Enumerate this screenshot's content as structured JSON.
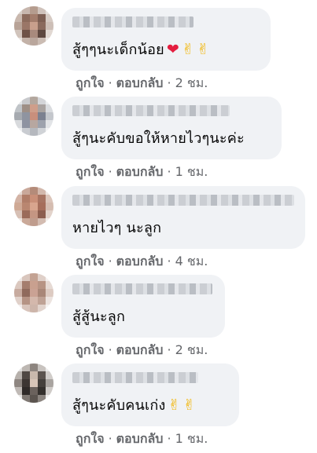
{
  "comments": [
    {
      "text": "สู้ๆๆนะเด็กน้อย",
      "emojis": [
        {
          "name": "heart-emoji",
          "glyph": "❤"
        },
        {
          "name": "victory-hand-emoji",
          "glyph": "✌"
        },
        {
          "name": "victory-hand-emoji",
          "glyph": "✌"
        }
      ],
      "like": "ถูกใจ",
      "reply": "ตอบกลับ",
      "time": "2 ชม."
    },
    {
      "text": "สู้ๆนะคับขอให้หายไวๆนะค่ะ",
      "emojis": [],
      "like": "ถูกใจ",
      "reply": "ตอบกลับ",
      "time": "1 ชม."
    },
    {
      "text": "หายไวๆ นะลูก",
      "emojis": [],
      "like": "ถูกใจ",
      "reply": "ตอบกลับ",
      "time": "4 ชม."
    },
    {
      "text": "สู้สู้นะลูก",
      "emojis": [],
      "like": "ถูกใจ",
      "reply": "ตอบกลับ",
      "time": "2 ชม."
    },
    {
      "text": "สู้ๆนะคับคนเก่ง",
      "emojis": [
        {
          "name": "victory-hand-emoji",
          "glyph": "✌"
        },
        {
          "name": "victory-hand-emoji",
          "glyph": "✌"
        }
      ],
      "like": "ถูกใจ",
      "reply": "ตอบกลับ",
      "time": "1 ชม."
    }
  ],
  "colors": {
    "bubble": "#f0f2f5",
    "action_text": "#65676b",
    "comment_text": "#050505"
  }
}
